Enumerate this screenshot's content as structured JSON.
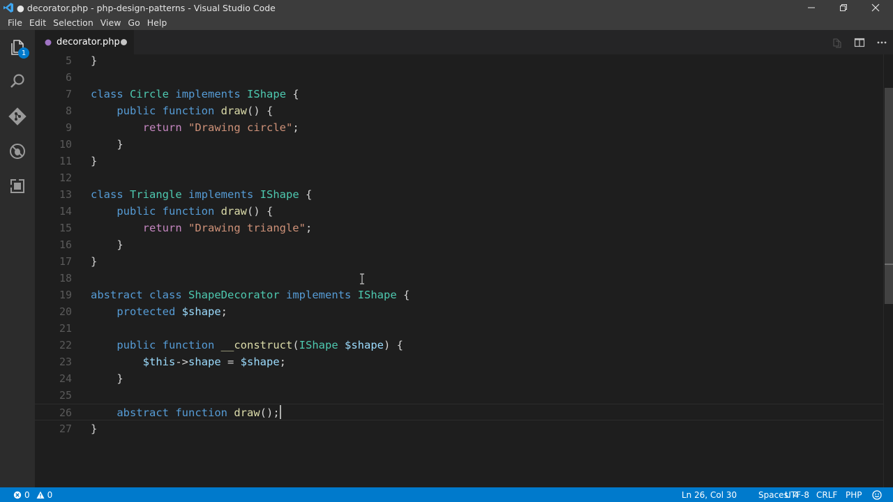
{
  "window": {
    "title": "● decorator.php - php-design-patterns - Visual Studio Code",
    "icon": "vscode-logo-icon",
    "controls": [
      "minimize-icon",
      "restore-icon",
      "close-icon"
    ]
  },
  "menu": [
    "File",
    "Edit",
    "Selection",
    "View",
    "Go",
    "Help"
  ],
  "activity_bar": {
    "items": [
      "explorer-icon",
      "search-icon",
      "git-icon",
      "debug-icon",
      "extensions-icon"
    ],
    "explorer_badge": "1"
  },
  "tab": {
    "label": "decorator.php",
    "dirty": true,
    "actions": [
      "open-changes-icon",
      "split-editor-icon",
      "more-actions-icon"
    ]
  },
  "editor": {
    "language": "PHP",
    "current_line": 26,
    "lines": [
      {
        "n": "5",
        "text": "}"
      },
      {
        "n": "6",
        "text": ""
      },
      {
        "n": "7",
        "text": "class Circle implements IShape {"
      },
      {
        "n": "8",
        "text": "    public function draw() {"
      },
      {
        "n": "9",
        "text": "        return \"Drawing circle\";"
      },
      {
        "n": "10",
        "text": "    }"
      },
      {
        "n": "11",
        "text": "}"
      },
      {
        "n": "12",
        "text": ""
      },
      {
        "n": "13",
        "text": "class Triangle implements IShape {"
      },
      {
        "n": "14",
        "text": "    public function draw() {"
      },
      {
        "n": "15",
        "text": "        return \"Drawing triangle\";"
      },
      {
        "n": "16",
        "text": "    }"
      },
      {
        "n": "17",
        "text": "}"
      },
      {
        "n": "18",
        "text": ""
      },
      {
        "n": "19",
        "text": "abstract class ShapeDecorator implements IShape {"
      },
      {
        "n": "20",
        "text": "    protected $shape;"
      },
      {
        "n": "21",
        "text": ""
      },
      {
        "n": "22",
        "text": "    public function __construct(IShape $shape) {"
      },
      {
        "n": "23",
        "text": "        $this->shape = $shape;"
      },
      {
        "n": "24",
        "text": "    }"
      },
      {
        "n": "25",
        "text": ""
      },
      {
        "n": "26",
        "text": "    abstract function draw();"
      },
      {
        "n": "27",
        "text": "}"
      }
    ]
  },
  "status": {
    "errors": "0",
    "warnings": "0",
    "position": "Ln 26, Col 30",
    "spaces": "Spaces: 4",
    "encoding": "UTF-8",
    "eol": "CRLF",
    "language": "PHP",
    "feedback_icon": "smiley-icon"
  },
  "colors": {
    "accent": "#007acc",
    "keyword": "#569cd6",
    "class_name": "#4ec9b0",
    "function_name": "#dcdcaa",
    "string": "#ce9178",
    "variable": "#9cdcfe",
    "control_keyword": "#c586c0"
  }
}
